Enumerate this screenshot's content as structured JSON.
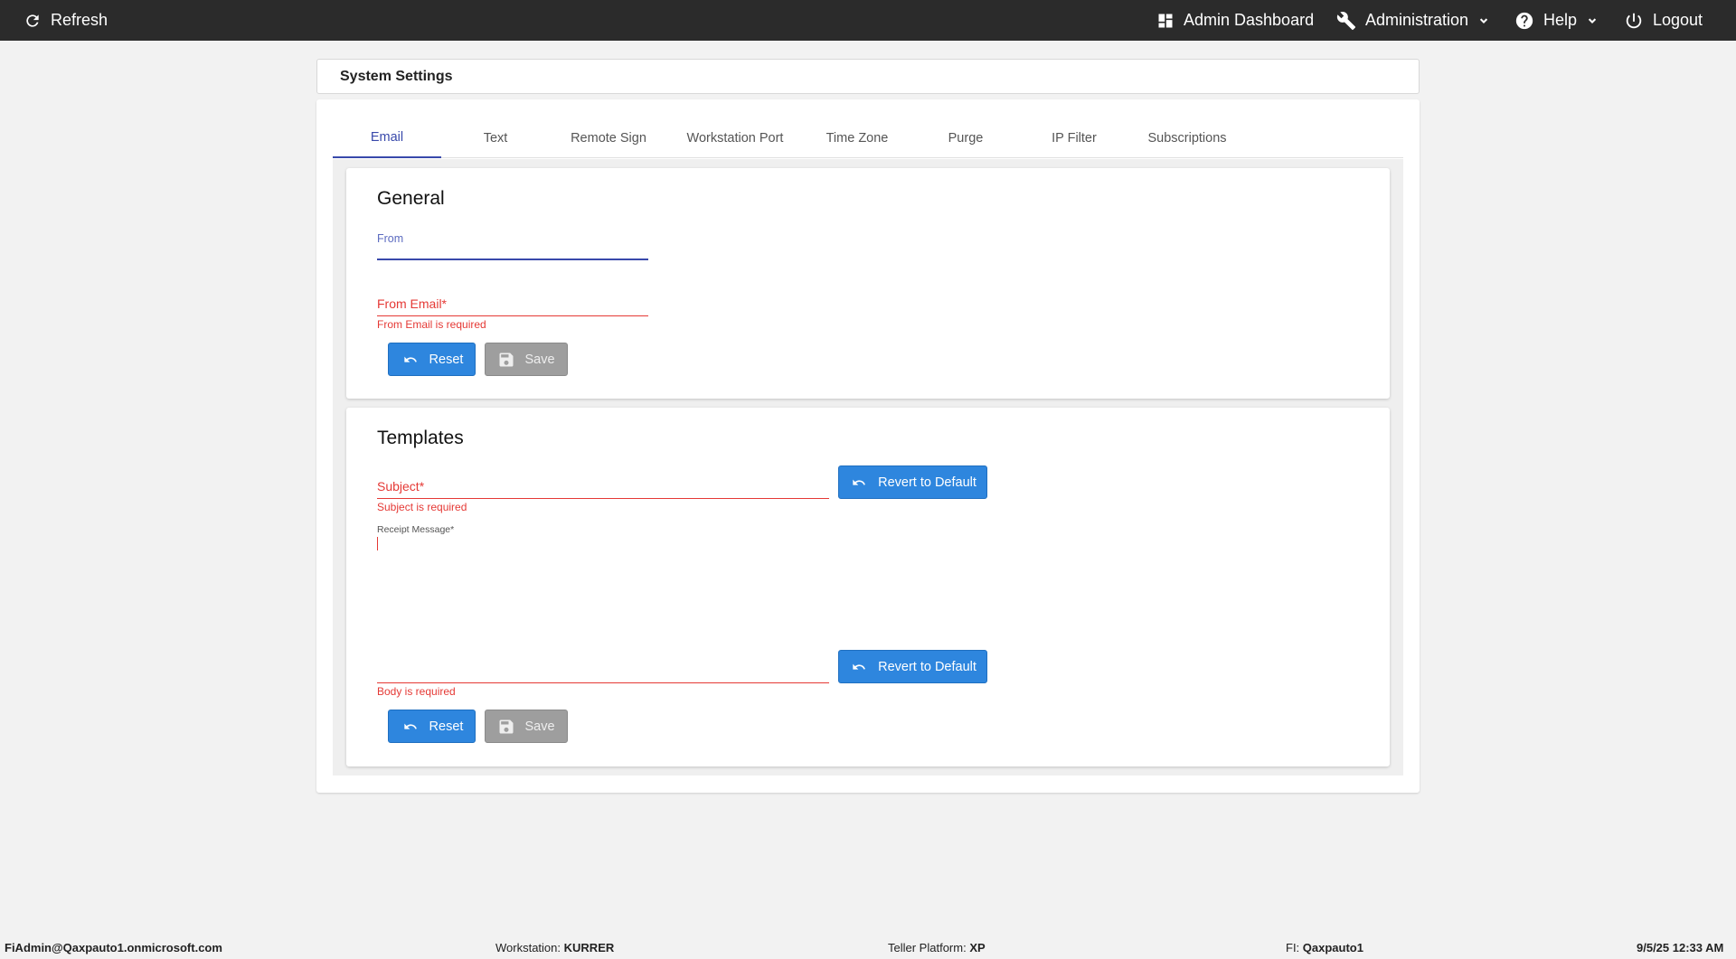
{
  "topbar": {
    "refresh": "Refresh",
    "admin_dashboard": "Admin Dashboard",
    "administration": "Administration",
    "help": "Help",
    "logout": "Logout"
  },
  "header": {
    "title": "System Settings"
  },
  "tabs": [
    {
      "label": "Email",
      "active": true
    },
    {
      "label": "Text"
    },
    {
      "label": "Remote Sign"
    },
    {
      "label": "Workstation Port"
    },
    {
      "label": "Time Zone"
    },
    {
      "label": "Purge"
    },
    {
      "label": "IP Filter"
    },
    {
      "label": "Subscriptions"
    }
  ],
  "general": {
    "title": "General",
    "from_label": "From",
    "from_value": "",
    "from_email_label": "From Email*",
    "from_email_value": "",
    "from_email_error": "From Email is required",
    "reset": "Reset",
    "save": "Save"
  },
  "templates": {
    "title": "Templates",
    "subject_label": "Subject*",
    "subject_value": "",
    "subject_error": "Subject is required",
    "revert": "Revert to Default",
    "receipt_label": "Receipt Message*",
    "receipt_value": "",
    "body_error": "Body is required",
    "reset": "Reset",
    "save": "Save"
  },
  "statusbar": {
    "user": "FiAdmin@Qaxpauto1.onmicrosoft.com",
    "workstation_label": "Workstation:",
    "workstation_value": "KURRER",
    "platform_label": "Teller Platform:",
    "platform_value": "XP",
    "fi_label": "FI:",
    "fi_value": "Qaxpauto1",
    "datetime": "9/5/25 12:33 AM"
  },
  "colors": {
    "accent": "#3949ab",
    "error": "#e53935",
    "button_blue": "#2e86de",
    "button_disabled": "#9e9e9e",
    "topbar": "#2b2b2b"
  }
}
